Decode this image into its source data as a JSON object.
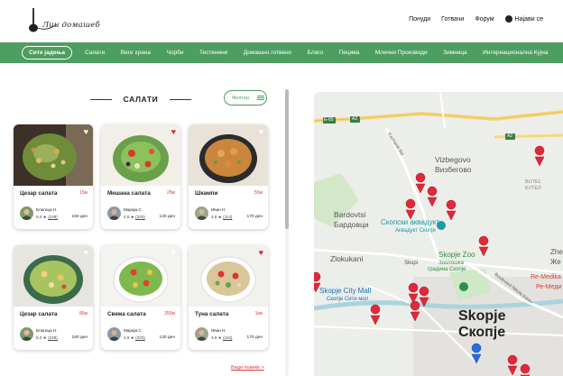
{
  "header": {
    "logo_text": "Лии домашеб",
    "links": [
      "Понуди",
      "Готвачи",
      "Форум"
    ],
    "login_label": "Најави се"
  },
  "nav": {
    "items": [
      "Сите јадења",
      "Салати",
      "Веге храна",
      "Чорби",
      "Тестенини",
      "Домашно готвено",
      "Благо",
      "Пецива",
      "Млечни Производи",
      "Зимница",
      "Интернационална Кујна"
    ],
    "active_index": 0
  },
  "section": {
    "title": "САЛАТИ",
    "filter_label": "Филтер"
  },
  "recipes": [
    {
      "name": "Цезар салата",
      "time": "15м",
      "author": "Благица Н.",
      "rating": "5.0",
      "reviews": "(238)",
      "days": "150 ден",
      "favorite": false
    },
    {
      "name": "Мешана салата",
      "time": "25м",
      "author": "Марија С.",
      "rating": "4.8",
      "reviews": "(220)",
      "days": "130 ден",
      "favorite": true
    },
    {
      "name": "Шкампи",
      "time": "55м",
      "author": "Иван Н.",
      "rating": "4.8",
      "reviews": "(114)",
      "days": "170 ден",
      "favorite": false
    },
    {
      "name": "Цезар салата",
      "time": "85м",
      "author": "Благица Н.",
      "rating": "5.0",
      "reviews": "(238)",
      "days": "150 ден",
      "favorite": false
    },
    {
      "name": "Свежа салата",
      "time": "250м",
      "author": "Марија С.",
      "rating": "4.8",
      "reviews": "(220)",
      "days": "130 ден",
      "favorite": false
    },
    {
      "name": "Туна салата",
      "time": "1км",
      "author": "Иван Н.",
      "rating": "4.8",
      "reviews": "(116)",
      "days": "170 ден",
      "favorite": true
    }
  ],
  "more_label": "Види повеќе >",
  "map": {
    "labels": {
      "e65": "E-65",
      "a2a": "A2",
      "a2b": "A2",
      "kacanik": "Kachanik Rd",
      "vizbegovo": "Vizbegovo",
      "vizbegovo_mk": "Визбегово",
      "butel": "BUTEL",
      "butel_mk": "БУТЕЛ",
      "bardovtsi": "Bardovtsi",
      "bardovtsi_mk": "Бардовци",
      "aqua": "Скопски аквадукт",
      "aqua_en": "Аквадукт Скопје",
      "zlokukani": "Zlokukani",
      "skupi": "Skupi",
      "zoo": "Skopje Zoo",
      "zoo_mk1": "Зоолошка",
      "zoo_mk2": "градина Скопје",
      "mall": "Skopje City Mall",
      "mall_mk": "Скопје Сити мол",
      "city": "Skopje",
      "city_mk": "Скопје",
      "boulevard": "Boulevard Nikola Karev",
      "remedika": "Re-Medika",
      "remedika_mk": "Ре-Меди",
      "zhe": "Zhe",
      "zhe_mk": "Же"
    },
    "colors": {
      "pin": "#e0283a",
      "road_major": "#f6d77a",
      "park": "#cfe8c7",
      "water": "#aad3df"
    }
  }
}
